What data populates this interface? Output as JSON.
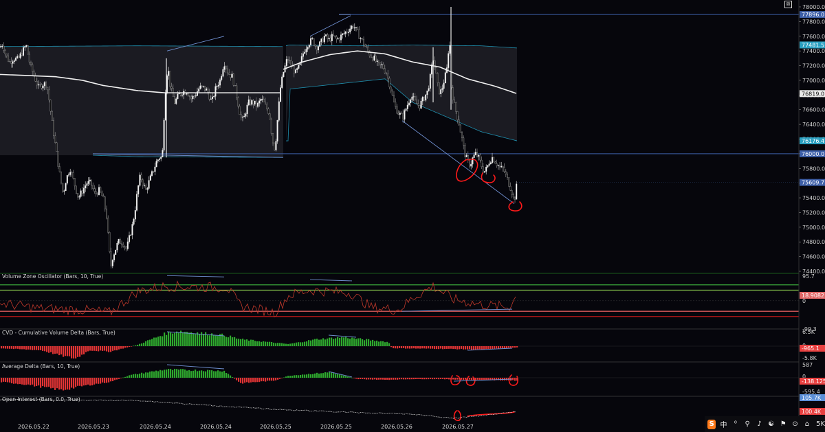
{
  "chart_data": {
    "type": "candlestick",
    "price_axis": {
      "min": 74400,
      "max": 78000,
      "ticks": [
        "78000.0",
        "77800.0",
        "77600.0",
        "77400.0",
        "77200.0",
        "77000.0",
        "76800.0",
        "76600.0",
        "76400.0",
        "76200.0",
        "76000.0",
        "75800.0",
        "75600.0",
        "75400.0",
        "75200.0",
        "75000.0",
        "74800.0",
        "74600.0",
        "74400.0"
      ],
      "tags": [
        {
          "label": "77896.0",
          "value": 77896.0,
          "color": "#3d5fa8"
        },
        {
          "label": "77481.5",
          "value": 77481.5,
          "color": "#2a9fc0"
        },
        {
          "label": "76819.0",
          "value": 76819.0,
          "color": "#e8e8e8"
        },
        {
          "label": "76176.4",
          "value": 76176.4,
          "color": "#2a9fc0"
        },
        {
          "label": "76000.0",
          "value": 76000.0,
          "color": "#3d5fa8"
        },
        {
          "label": "75609.7",
          "value": 75609.7,
          "color": "#3d5fa8"
        }
      ],
      "horizontal_levels": [
        77896.0,
        76000.0
      ]
    },
    "date_axis": [
      "2026.05.22",
      "2026.05.23",
      "2026.05.24",
      "2026.05.24",
      "2026.05.25",
      "2026.05.25",
      "2026.05.26",
      "2026.05.27"
    ],
    "price_path": [
      [
        0,
        77450
      ],
      [
        4,
        77500
      ],
      [
        8,
        77350
      ],
      [
        14,
        77250
      ],
      [
        20,
        77300
      ],
      [
        26,
        77280
      ],
      [
        32,
        77380
      ],
      [
        38,
        77480
      ],
      [
        44,
        77200
      ],
      [
        50,
        77050
      ],
      [
        56,
        76900
      ],
      [
        62,
        76950
      ],
      [
        68,
        76950
      ],
      [
        72,
        76700
      ],
      [
        76,
        76400
      ],
      [
        80,
        76150
      ],
      [
        84,
        75900
      ],
      [
        88,
        75650
      ],
      [
        92,
        75450
      ],
      [
        96,
        75650
      ],
      [
        102,
        75800
      ],
      [
        108,
        75600
      ],
      [
        114,
        75400
      ],
      [
        120,
        75500
      ],
      [
        126,
        75600
      ],
      [
        132,
        75600
      ],
      [
        138,
        75450
      ],
      [
        144,
        75500
      ],
      [
        150,
        75400
      ],
      [
        155,
        75150
      ],
      [
        158,
        74800
      ],
      [
        161,
        74450
      ],
      [
        164,
        74600
      ],
      [
        168,
        74700
      ],
      [
        172,
        74800
      ],
      [
        178,
        74800
      ],
      [
        184,
        74700
      ],
      [
        188,
        74850
      ],
      [
        192,
        75000
      ],
      [
        196,
        75200
      ],
      [
        200,
        75500
      ],
      [
        204,
        75700
      ],
      [
        208,
        75600
      ],
      [
        212,
        75500
      ],
      [
        216,
        75600
      ],
      [
        220,
        75700
      ],
      [
        224,
        75800
      ],
      [
        228,
        75900
      ],
      [
        232,
        75950
      ],
      [
        236,
        75950
      ],
      [
        240,
        76800
      ],
      [
        244,
        77200
      ],
      [
        248,
        76900
      ],
      [
        254,
        76700
      ],
      [
        260,
        76800
      ],
      [
        266,
        76850
      ],
      [
        272,
        76850
      ],
      [
        278,
        76750
      ],
      [
        284,
        76800
      ],
      [
        290,
        76900
      ],
      [
        296,
        76900
      ],
      [
        302,
        76850
      ],
      [
        308,
        76700
      ],
      [
        314,
        76900
      ],
      [
        320,
        77000
      ],
      [
        326,
        77250
      ],
      [
        332,
        77100
      ],
      [
        338,
        77050
      ],
      [
        344,
        76800
      ],
      [
        350,
        76500
      ],
      [
        354,
        76450
      ],
      [
        358,
        76600
      ],
      [
        362,
        76700
      ],
      [
        368,
        76700
      ],
      [
        374,
        76650
      ],
      [
        380,
        76750
      ],
      [
        386,
        76650
      ],
      [
        392,
        76550
      ],
      [
        396,
        76200
      ],
      [
        400,
        76050
      ],
      [
        404,
        76500
      ],
      [
        408,
        76900
      ],
      [
        412,
        77100
      ],
      [
        418,
        77300
      ],
      [
        424,
        77200
      ],
      [
        430,
        77100
      ],
      [
        436,
        77200
      ],
      [
        442,
        77400
      ],
      [
        448,
        77500
      ],
      [
        454,
        77550
      ],
      [
        460,
        77450
      ],
      [
        466,
        77500
      ],
      [
        472,
        77600
      ],
      [
        478,
        77550
      ],
      [
        484,
        77600
      ],
      [
        490,
        77550
      ],
      [
        496,
        77600
      ],
      [
        502,
        77650
      ],
      [
        508,
        77700
      ],
      [
        514,
        77750
      ],
      [
        520,
        77650
      ],
      [
        526,
        77550
      ],
      [
        532,
        77450
      ],
      [
        538,
        77350
      ],
      [
        544,
        77300
      ],
      [
        550,
        77200
      ],
      [
        556,
        77200
      ],
      [
        562,
        77100
      ],
      [
        568,
        76900
      ],
      [
        574,
        76650
      ],
      [
        580,
        76550
      ],
      [
        586,
        76500
      ],
      [
        592,
        76650
      ],
      [
        598,
        76800
      ],
      [
        604,
        76700
      ],
      [
        610,
        76650
      ],
      [
        616,
        76750
      ],
      [
        622,
        76850
      ],
      [
        626,
        77050
      ],
      [
        630,
        77300
      ],
      [
        634,
        77100
      ],
      [
        638,
        76850
      ],
      [
        642,
        76850
      ],
      [
        646,
        77000
      ],
      [
        650,
        77150
      ],
      [
        654,
        77600
      ],
      [
        656,
        76950
      ],
      [
        660,
        76700
      ],
      [
        664,
        76550
      ],
      [
        668,
        76400
      ],
      [
        672,
        76200
      ],
      [
        676,
        76000
      ],
      [
        680,
        75900
      ],
      [
        684,
        75850
      ],
      [
        688,
        75950
      ],
      [
        692,
        76000
      ],
      [
        696,
        75950
      ],
      [
        700,
        75850
      ],
      [
        704,
        75750
      ],
      [
        708,
        75800
      ],
      [
        712,
        75900
      ],
      [
        716,
        75950
      ],
      [
        720,
        75900
      ],
      [
        724,
        75850
      ],
      [
        728,
        75800
      ],
      [
        732,
        75800
      ],
      [
        736,
        75700
      ],
      [
        740,
        75600
      ],
      [
        744,
        75500
      ],
      [
        748,
        75350
      ],
      [
        752,
        75600
      ]
    ],
    "moving_average": [
      [
        0,
        77080
      ],
      [
        80,
        77050
      ],
      [
        120,
        77000
      ],
      [
        150,
        76930
      ],
      [
        200,
        76860
      ],
      [
        240,
        76830
      ],
      [
        300,
        76830
      ],
      [
        360,
        76830
      ],
      [
        408,
        76830
      ],
      [
        412,
        77150
      ],
      [
        440,
        77250
      ],
      [
        480,
        77350
      ],
      [
        520,
        77400
      ],
      [
        560,
        77360
      ],
      [
        600,
        77250
      ],
      [
        640,
        77180
      ],
      [
        680,
        77020
      ],
      [
        720,
        76920
      ],
      [
        752,
        76819
      ]
    ],
    "vwap_band_upper": [
      [
        0,
        77460
      ],
      [
        200,
        77470
      ],
      [
        412,
        77460
      ],
      [
        420,
        77480
      ],
      [
        520,
        77470
      ],
      [
        600,
        77480
      ],
      [
        700,
        77470
      ],
      [
        752,
        77440
      ]
    ],
    "vwap_band_lower": [
      [
        135,
        75980
      ],
      [
        200,
        75960
      ],
      [
        240,
        75940
      ],
      [
        412,
        75950
      ],
      [
        420,
        76880
      ],
      [
        560,
        77020
      ],
      [
        600,
        76700
      ],
      [
        650,
        76500
      ],
      [
        700,
        76300
      ],
      [
        752,
        76176
      ]
    ],
    "trendlines": [
      {
        "from": [
          243,
          77400
        ],
        "to": [
          326,
          77600
        ]
      },
      {
        "from": [
          451,
          77600
        ],
        "to": [
          510,
          77880
        ]
      },
      {
        "from": [
          585,
          76450
        ],
        "to": [
          748,
          75320
        ]
      },
      {
        "from": [
          135,
          76000
        ],
        "to": [
          412,
          75950
        ]
      }
    ],
    "panes": [
      {
        "title": "Volume Zone Oscillator (Bars, 10, True)",
        "axis_labels": [
          "95.7",
          "0",
          "-99.3"
        ],
        "current_tag": "18.9082",
        "current_color": "#e06666",
        "levels": [
          60,
          40,
          -40,
          -60
        ]
      },
      {
        "title": "CVD - Cumulative Volume Delta (Bars, True)",
        "axis_labels": [
          "6.5K",
          "0",
          "-5.8K"
        ],
        "current_tag": "-965.1",
        "current_color": "#e84040"
      },
      {
        "title": "Average Delta (Bars, 10, True)",
        "axis_labels": [
          "587",
          "0",
          "-595.4"
        ],
        "current_tag": "-138.125",
        "current_color": "#e84040"
      },
      {
        "title": "Open Interest (Bars, 0.0, True)",
        "axis_labels": [],
        "current_tag": "100.4K",
        "current_color": "#e84040",
        "top_tag": "105.7K"
      }
    ]
  },
  "taskbar": {
    "icons": [
      "S",
      "中",
      "⁰",
      "⚲",
      "♪",
      "☯",
      "⚑",
      "⊙",
      "⌂"
    ],
    "extra_label": "5K"
  },
  "corner_button_symbol": "⊠"
}
